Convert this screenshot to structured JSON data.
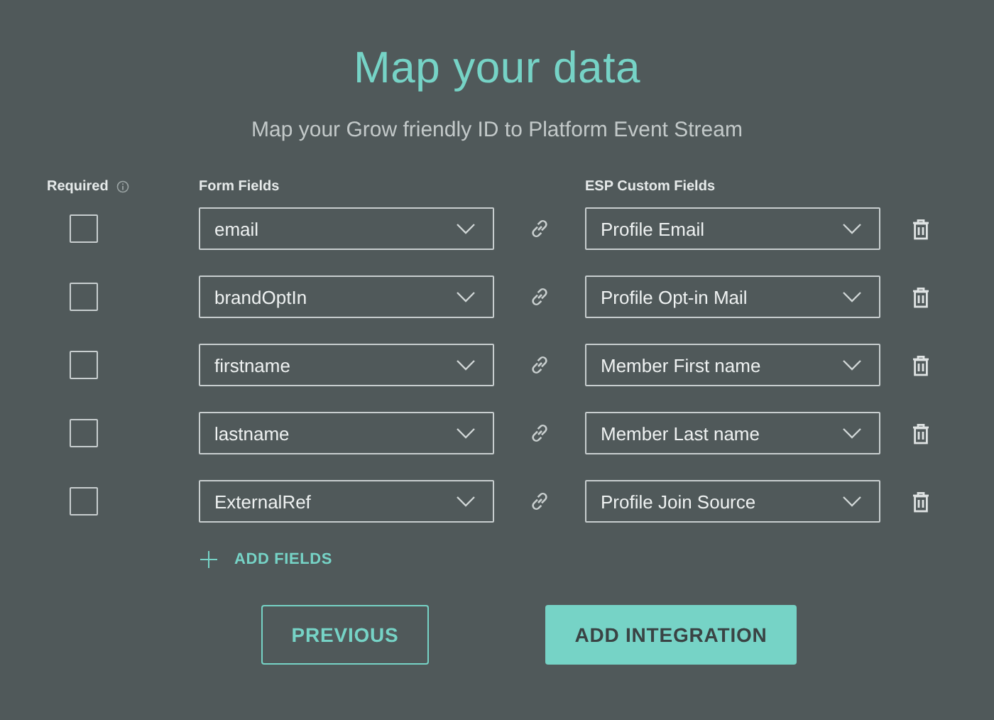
{
  "title": "Map your data",
  "subtitle": "Map your Grow friendly ID to Platform Event Stream",
  "columns": {
    "required": "Required",
    "form_fields": "Form Fields",
    "esp_fields": "ESP Custom Fields"
  },
  "rows": [
    {
      "required": false,
      "form_field": "email",
      "esp_field": "Profile Email"
    },
    {
      "required": false,
      "form_field": "brandOptIn",
      "esp_field": "Profile Opt-in Mail"
    },
    {
      "required": false,
      "form_field": "firstname",
      "esp_field": "Member First name"
    },
    {
      "required": false,
      "form_field": "lastname",
      "esp_field": "Member Last name"
    },
    {
      "required": false,
      "form_field": "ExternalRef",
      "esp_field": "Profile Join Source"
    }
  ],
  "add_fields": "ADD FIELDS",
  "buttons": [
    {
      "kind": "secondary",
      "label": "PREVIOUS"
    },
    {
      "kind": "primary",
      "label": "ADD INTEGRATION"
    }
  ]
}
